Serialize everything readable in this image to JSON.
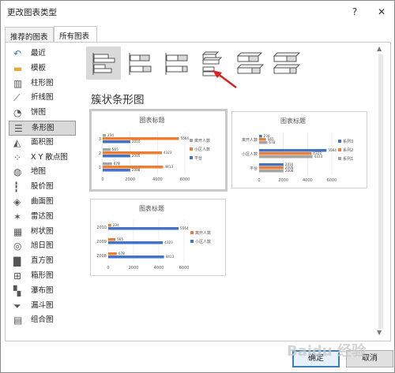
{
  "window": {
    "title": "更改图表类型",
    "help": "?",
    "close": "✕"
  },
  "tabs": [
    {
      "label": "推荐的图表"
    },
    {
      "label": "所有图表"
    }
  ],
  "sidebar": {
    "items": [
      {
        "label": "最近",
        "icon": "undo-icon"
      },
      {
        "label": "模板",
        "icon": "folder-icon"
      },
      {
        "label": "柱形图",
        "icon": "column-chart-icon"
      },
      {
        "label": "折线图",
        "icon": "line-chart-icon"
      },
      {
        "label": "饼图",
        "icon": "pie-chart-icon"
      },
      {
        "label": "条形图",
        "icon": "bar-chart-icon",
        "selected": true
      },
      {
        "label": "面积图",
        "icon": "area-chart-icon"
      },
      {
        "label": "X Y 散点图",
        "icon": "scatter-chart-icon"
      },
      {
        "label": "地图",
        "icon": "map-chart-icon"
      },
      {
        "label": "股价图",
        "icon": "stock-chart-icon"
      },
      {
        "label": "曲面图",
        "icon": "surface-chart-icon"
      },
      {
        "label": "雷达图",
        "icon": "radar-chart-icon"
      },
      {
        "label": "树状图",
        "icon": "treemap-chart-icon"
      },
      {
        "label": "旭日图",
        "icon": "sunburst-chart-icon"
      },
      {
        "label": "直方图",
        "icon": "histogram-chart-icon"
      },
      {
        "label": "箱形图",
        "icon": "box-whisker-chart-icon"
      },
      {
        "label": "瀑布图",
        "icon": "waterfall-chart-icon"
      },
      {
        "label": "漏斗图",
        "icon": "funnel-chart-icon"
      },
      {
        "label": "组合图",
        "icon": "combo-chart-icon"
      }
    ]
  },
  "subtypes_label": "簇状条形图",
  "colors": {
    "blue": "#4472c4",
    "orange": "#ed7d31",
    "gray": "#a5a5a5",
    "accent": "#3c7fb1",
    "arrow": "#e02020"
  },
  "chart_data": [
    {
      "type": "bar",
      "title": "图表标题",
      "categories": [
        "1",
        "2",
        "3"
      ],
      "series": [
        {
          "name": "平台",
          "values": [
            2008,
            2005,
            2010
          ]
        },
        {
          "name": "小区人数",
          "values": [
            4413,
            4323,
            5564
          ]
        },
        {
          "name": "离开人数",
          "values": [
            678,
            565,
            234
          ]
        }
      ],
      "xticks": [
        "0",
        "2000",
        "4000",
        "6000"
      ],
      "xlim": [
        0,
        6000
      ],
      "legend": "right"
    },
    {
      "type": "bar",
      "title": "图表标题",
      "categories": [
        "平台",
        "小区人数",
        "离开人数"
      ],
      "series": [
        {
          "name": "系列1",
          "values": [
            2008,
            4413,
            678
          ]
        },
        {
          "name": "系列2",
          "values": [
            2005,
            4323,
            565
          ]
        },
        {
          "name": "系列3",
          "values": [
            2010,
            5564,
            234
          ]
        }
      ],
      "xticks": [
        "0",
        "2000",
        "4000",
        "6000"
      ],
      "xlim": [
        0,
        6000
      ],
      "legend": "right"
    },
    {
      "type": "bar",
      "title": "图表标题",
      "categories": [
        "2008",
        "2009",
        "2010"
      ],
      "series": [
        {
          "name": "小区人数",
          "values": [
            4413,
            4323,
            5564
          ]
        },
        {
          "name": "离开人数",
          "values": [
            678,
            565,
            234
          ]
        }
      ],
      "xticks": [
        "0",
        "2000",
        "4000",
        "6000"
      ],
      "xlim": [
        0,
        6000
      ],
      "legend": "right"
    }
  ],
  "buttons": {
    "ok": "确定",
    "cancel": "取消"
  },
  "watermark": "Baidu 经验"
}
